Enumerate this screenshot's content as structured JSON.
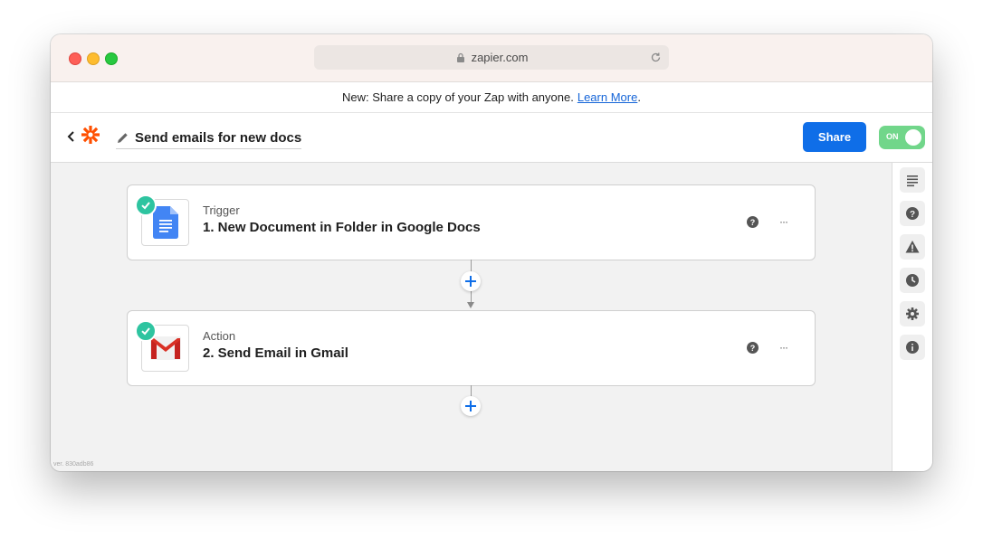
{
  "browser": {
    "url": "zapier.com",
    "icons": [
      "lock-icon",
      "reload-icon"
    ],
    "traffic_lights": [
      "#fe5f57",
      "#febc2e",
      "#28c840"
    ]
  },
  "banner": {
    "text": "New: Share a copy of your Zap with anyone.",
    "link_label": "Learn More",
    "suffix": "."
  },
  "header": {
    "zap_name": "Send emails for new docs",
    "share_label": "Share",
    "toggle_label": "ON",
    "toggle_on": true
  },
  "steps": [
    {
      "type": "Trigger",
      "title": "1. New Document in Folder in Google Docs",
      "app_icon": "google-docs-icon",
      "status": "complete"
    },
    {
      "type": "Action",
      "title": "2. Send Email in Gmail",
      "app_icon": "gmail-icon",
      "status": "complete"
    }
  ],
  "step_menu_label": "···",
  "sidebar": {
    "items": [
      "outline-icon",
      "help-icon",
      "warning-icon",
      "history-icon",
      "settings-icon",
      "info-icon"
    ]
  },
  "version": "ver. 830adb86",
  "colors": {
    "accent": "#0f6ee8",
    "toggle_on": "#71d68a",
    "check": "#2ec4a0",
    "zapier_orange": "#ff4f00",
    "link": "#1565d8"
  }
}
